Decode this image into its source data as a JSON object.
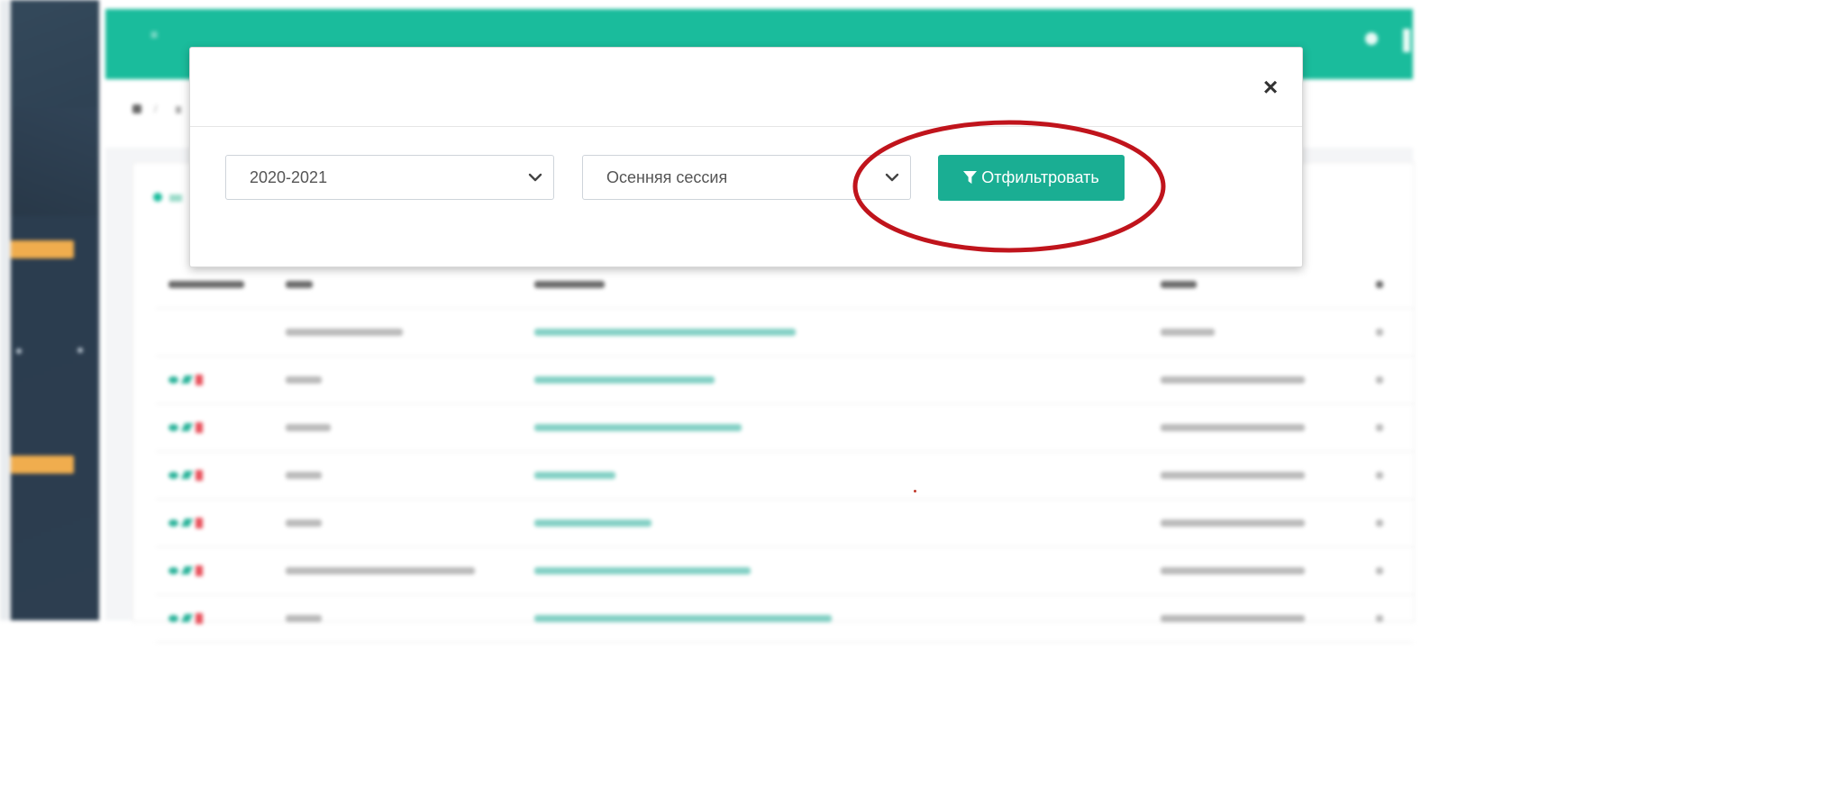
{
  "modal": {
    "close_label": "×",
    "year_select": {
      "value": "2020-2021"
    },
    "session_select": {
      "value": "Осенняя сессия"
    },
    "filter_button_label": "Отфильтровать"
  },
  "table": {
    "rows": [
      {
        "actions": false,
        "type_w": 130,
        "name_w": 290,
        "author_w": 60
      },
      {
        "actions": true,
        "type_w": 40,
        "name_w": 200,
        "author_w": 160
      },
      {
        "actions": true,
        "type_w": 50,
        "name_w": 230,
        "author_w": 160
      },
      {
        "actions": true,
        "type_w": 40,
        "name_w": 90,
        "author_w": 160
      },
      {
        "actions": true,
        "type_w": 40,
        "name_w": 130,
        "author_w": 160
      },
      {
        "actions": true,
        "type_w": 210,
        "name_w": 240,
        "author_w": 160
      },
      {
        "actions": true,
        "type_w": 40,
        "name_w": 330,
        "author_w": 160
      }
    ]
  },
  "colors": {
    "accent": "#1abc9c",
    "button": "#1aae93",
    "highlight_ellipse": "#c0141c",
    "sidebar": "#2d3e50",
    "badge": "#f0ad4e",
    "danger": "#e8505b"
  },
  "icons": {
    "close": "close-icon",
    "dropdown": "chevron-down-icon",
    "filter": "filter-icon",
    "menu": "hamburger-icon"
  }
}
